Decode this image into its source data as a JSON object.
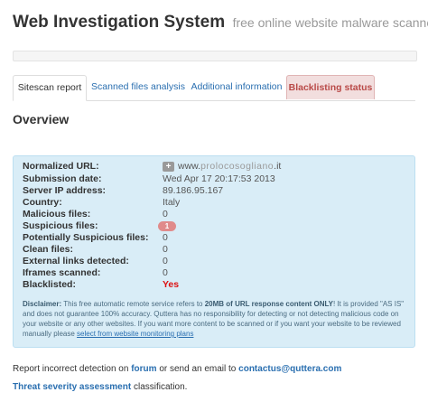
{
  "header": {
    "title": "Web Investigation System",
    "subtitle": "free online website malware scanner"
  },
  "tabs": [
    {
      "label": "Sitescan report",
      "state": "active"
    },
    {
      "label": "Scanned files analysis",
      "state": "link"
    },
    {
      "label": "Additional information",
      "state": "link"
    },
    {
      "label": "Blacklisting status",
      "state": "danger"
    }
  ],
  "overview": {
    "title": "Overview",
    "fields": [
      {
        "label": "Normalized URL:",
        "value": "www.prolocosogliano.it"
      },
      {
        "label": "Submission date:",
        "value": "Wed Apr 17 20:17:53 2013"
      },
      {
        "label": "Server IP address:",
        "value": "89.186.95.167"
      },
      {
        "label": "Country:",
        "value": "Italy"
      },
      {
        "label": "Malicious files:",
        "value": "0"
      },
      {
        "label": "Suspicious files:",
        "value": "1"
      },
      {
        "label": "Potentially Suspicious files:",
        "value": "0"
      },
      {
        "label": "Clean files:",
        "value": "0"
      },
      {
        "label": "External links detected:",
        "value": "0"
      },
      {
        "label": "Iframes scanned:",
        "value": "0"
      },
      {
        "label": "Blacklisted:",
        "value": "Yes"
      }
    ],
    "url_prefix": "www.",
    "url_blurred": "prolocosogliano",
    "url_suffix": ".it"
  },
  "disclaimer": {
    "label": "Disclaimer:",
    "text1": "This free automatic remote service refers to",
    "bold": "20MB of URL response content ONLY",
    "text2": "! It is provided \"AS IS\" and does not guarantee 100% accuracy. Quttera has no responsibility for detecting or not detecting malicious code on your website or any other websites. If you want more content to be scanned or if you want your website to be reviewed manually please",
    "link": "select from website monitoring plans"
  },
  "footer": {
    "report_prefix": "Report incorrect detection on",
    "forum": "forum",
    "report_mid": "or send an email to",
    "email": "contactus@quttera.com",
    "threat_link": "Threat severity assessment",
    "threat_suffix": "classification."
  },
  "colors": {
    "panel_bg": "#d9edf7",
    "link": "#2a6fb0",
    "danger": "#b94a48",
    "blacklisted_yes": "#dd1111"
  },
  "icons": {
    "url_expand": "plus-icon"
  }
}
